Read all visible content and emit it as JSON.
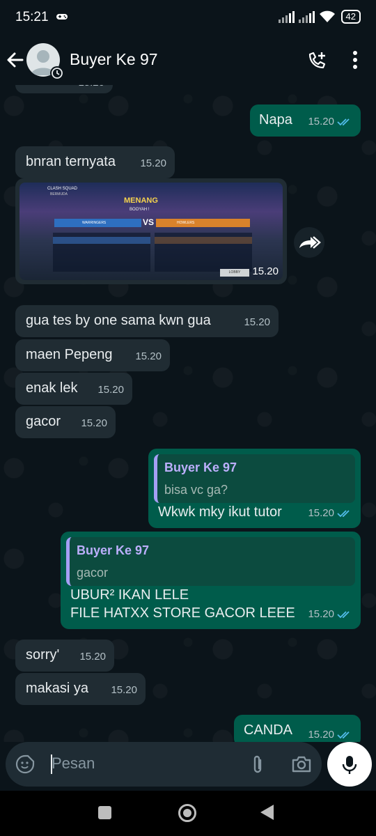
{
  "status": {
    "time": "15:21",
    "battery": "42"
  },
  "header": {
    "contact_name": "Buyer Ke 97"
  },
  "messages": {
    "partial_top": {
      "time": "15.20"
    },
    "m1": {
      "text": "Napa",
      "time": "15.20"
    },
    "m2": {
      "text": "bnran ternyata",
      "time": "15.20"
    },
    "m3": {
      "time": "15.20",
      "image": {
        "clash_squad": "CLASH SQUAD",
        "bermuda": "BERMUDA",
        "result": "MENANG",
        "booyah": "BOOYAH !",
        "team_left": "WARRINGERS",
        "team_right": "HOWLERS",
        "vs": "VS",
        "lobby": "LOBBY"
      }
    },
    "m4": {
      "text": "gua tes by one sama kwn gua",
      "time": "15.20"
    },
    "m5": {
      "text": "maen Pepeng",
      "time": "15.20"
    },
    "m6": {
      "text": "enak lek",
      "time": "15.20"
    },
    "m7": {
      "text": "gacor",
      "time": "15.20"
    },
    "m8": {
      "quote_name": "Buyer Ke 97",
      "quote_text": "bisa vc ga?",
      "text": "Wkwk mky ikut tutor",
      "time": "15.20"
    },
    "m9": {
      "quote_name": "Buyer Ke 97",
      "quote_text": "gacor",
      "line1": "UBUR² IKAN LELE",
      "line2": "FILE HATXX STORE GACOR LEEE",
      "time": "15.20"
    },
    "m10": {
      "text": "sorry'",
      "time": "15.20"
    },
    "m11": {
      "text": "makasi ya",
      "time": "15.20"
    },
    "m12": {
      "text": "CANDA",
      "time": "15.20"
    }
  },
  "composer": {
    "placeholder": "Pesan"
  },
  "colors": {
    "incoming": "#202c33",
    "outgoing": "#005c4b",
    "tick_read": "#53bdeb",
    "background": "#0b141a"
  }
}
